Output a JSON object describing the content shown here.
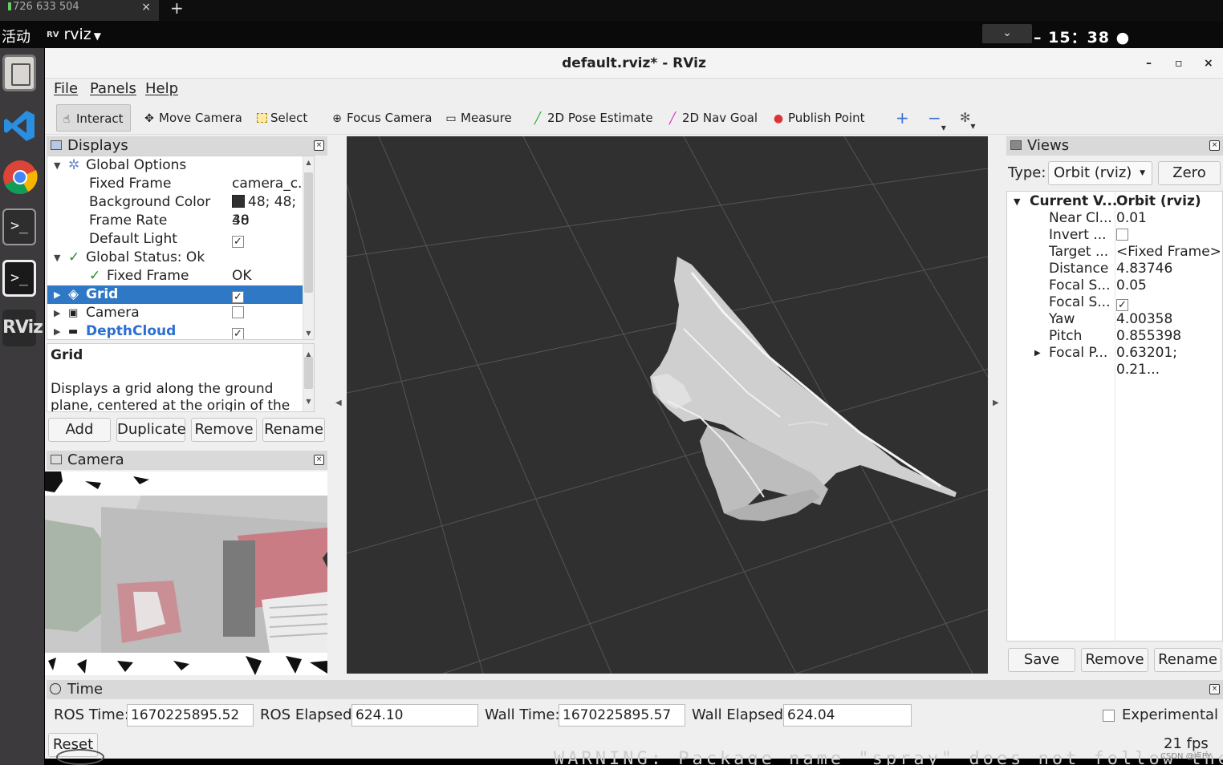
{
  "browser_tab": {
    "title": "726 633 504",
    "close": "×",
    "new_tab": "+"
  },
  "topbar": {
    "activities": "活动",
    "app_menu": "rviz",
    "clock": "15：38"
  },
  "window": {
    "title": "default.rviz* - RViz",
    "min": "–",
    "max": "▫",
    "close": "×"
  },
  "menu": {
    "file": "File",
    "panels": "Panels",
    "help": "Help"
  },
  "toolbar": {
    "interact": "Interact",
    "move_camera": "Move Camera",
    "select": "Select",
    "focus_camera": "Focus Camera",
    "measure": "Measure",
    "pose_estimate": "2D Pose Estimate",
    "nav_goal": "2D Nav Goal",
    "publish_point": "Publish Point"
  },
  "displays": {
    "title": "Displays",
    "rows": [
      {
        "label": "Global Options",
        "value": ""
      },
      {
        "label": "Fixed Frame",
        "value": "camera_c..."
      },
      {
        "label": "Background Color",
        "value": "48; 48; 48"
      },
      {
        "label": "Frame Rate",
        "value": "30"
      },
      {
        "label": "Default Light",
        "value": ""
      },
      {
        "label": "Global Status: Ok",
        "value": ""
      },
      {
        "label": "Fixed Frame",
        "value": "OK"
      },
      {
        "label": "Grid",
        "value": ""
      },
      {
        "label": "Camera",
        "value": ""
      },
      {
        "label": "DepthCloud",
        "value": ""
      }
    ],
    "desc_title": "Grid",
    "desc_text": "Displays a grid along the ground plane, centered at the origin of the target",
    "buttons": {
      "add": "Add",
      "duplicate": "Duplicate",
      "remove": "Remove",
      "rename": "Rename"
    }
  },
  "camera_panel": {
    "title": "Camera"
  },
  "views": {
    "title": "Views",
    "type_label": "Type:",
    "type_value": "Orbit (rviz)",
    "zero": "Zero",
    "rows": [
      {
        "label": "Current V...",
        "value": "Orbit (rviz)"
      },
      {
        "label": "Near Cl...",
        "value": "0.01"
      },
      {
        "label": "Invert ...",
        "value": ""
      },
      {
        "label": "Target ...",
        "value": "<Fixed Frame>"
      },
      {
        "label": "Distance",
        "value": "4.83746"
      },
      {
        "label": "Focal S...",
        "value": "0.05"
      },
      {
        "label": "Focal S...",
        "value": ""
      },
      {
        "label": "Yaw",
        "value": "4.00358"
      },
      {
        "label": "Pitch",
        "value": "0.855398"
      },
      {
        "label": "Focal P...",
        "value": "0.63201; 0.21..."
      }
    ],
    "buttons": {
      "save": "Save",
      "remove": "Remove",
      "rename": "Rename"
    }
  },
  "time": {
    "title": "Time",
    "ros_time_label": "ROS Time:",
    "ros_time": "1670225895.52",
    "ros_elapsed_label": "ROS Elapsed:",
    "ros_elapsed": "624.10",
    "wall_time_label": "Wall Time:",
    "wall_time": "1670225895.57",
    "wall_elapsed_label": "Wall Elapsed:",
    "wall_elapsed": "624.04",
    "experimental": "Experimental",
    "reset": "Reset",
    "fps": "21 fps"
  },
  "terminal_text": "WARNING: Package name \"spray\" does not follow the",
  "watermark": "CSDN @点PY",
  "colors": {
    "selection": "#2f78c6",
    "viewport_bg": "#303030",
    "swatch": "#303030"
  }
}
